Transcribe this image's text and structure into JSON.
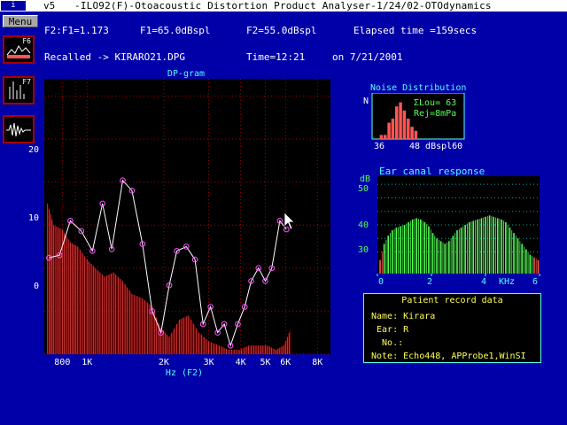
{
  "titlebar": {
    "system_button": "i",
    "version": "v5",
    "title": "-ILO92(F)-Otoacoustic Distortion Product Analyser-1/24/02-OTOdynamics"
  },
  "menu": {
    "label": "Menu"
  },
  "tools": [
    {
      "key": "F6",
      "icon": "dpgram-icon"
    },
    {
      "key": "F7",
      "icon": "spectrum-icon"
    },
    {
      "key": "",
      "icon": "waveform-icon"
    }
  ],
  "info": {
    "ratio": "F2:F1=1.173",
    "f1": "F1=65.0dBspl",
    "f2": "F2=55.0dBspl",
    "elapsed": "Elapsed time =159secs",
    "recalled": "Recalled -> KIRARO21.DPG",
    "time": "Time=12:21",
    "date": "on 7/21/2001"
  },
  "dpgram": {
    "title": "DP-gram",
    "xlabel": "Hz (F2)",
    "yticks": [
      "20",
      "10",
      "0"
    ],
    "xticks": [
      "800",
      "1K",
      "2K",
      "3K",
      "4K",
      "5K",
      "6K",
      "8K"
    ]
  },
  "noise": {
    "title": "Noise Distribution",
    "ylabel": "N",
    "lou": "ΣLou= 63",
    "rej": "Rej=8mPa",
    "xticks": [
      "36",
      "48 dBspl60"
    ]
  },
  "ear_canal": {
    "title": "Ear canal response",
    "yunit": "dB",
    "yticks": [
      "50",
      "40",
      "30"
    ],
    "xticks": [
      "0",
      "2",
      "4",
      "KHz",
      "6"
    ]
  },
  "patient": {
    "title": "Patient record data",
    "name_label": "Name:",
    "name_value": "Kirara",
    "ear_label": " Ear:",
    "ear_value": "R",
    "no_label": "  No.:",
    "no_value": "",
    "note_label": "Note:",
    "note_value": "Echo448, APProbe1,WinSI"
  },
  "chart_data": [
    {
      "type": "line",
      "title": "DP-gram",
      "xlabel": "Hz (F2)",
      "ylabel": "",
      "xscale": "log",
      "xlim": [
        680,
        9000
      ],
      "ylim": [
        -10,
        22
      ],
      "grid": true,
      "series": [
        {
          "x": [
            710,
            780,
            860,
            950,
            1050,
            1150,
            1250,
            1380,
            1500,
            1650,
            1800,
            1950,
            2100,
            2250,
            2450,
            2650,
            2850,
            3050,
            3250,
            3450,
            3650,
            3900,
            4150,
            4400,
            4700,
            5000,
            5300,
            5700,
            6050
          ],
          "values": [
            1.2,
            1.5,
            5.5,
            4.3,
            2,
            7.5,
            2.2,
            10.2,
            9,
            2.8,
            -5,
            -7.5,
            -2,
            2,
            2.5,
            1,
            -6.5,
            -4.5,
            -7.5,
            -6.5,
            -9,
            -6.5,
            -4.5,
            -1.5,
            0,
            -1.5,
            0,
            5.5,
            4.5
          ]
        }
      ],
      "noise_floor_series": {
        "x": [
          700,
          740,
          800,
          860,
          920,
          1000,
          1080,
          1170,
          1270,
          1380,
          1500,
          1650,
          1800,
          1950,
          2100,
          2300,
          2500,
          2750,
          3000,
          3300,
          3600,
          3950,
          4300,
          4700,
          5100,
          5500,
          5900,
          6300
        ],
        "values": [
          7.5,
          5,
          4.5,
          3,
          2.5,
          1,
          0,
          -1,
          -0.5,
          -1.5,
          -3,
          -3.5,
          -4.5,
          -7,
          -8,
          -6,
          -5.5,
          -7.5,
          -8.5,
          -9,
          -9.5,
          -9.5,
          -9,
          -9,
          -9,
          -9.5,
          -9,
          -7
        ]
      }
    },
    {
      "type": "bar",
      "title": "Noise Distribution",
      "xlim": [
        36,
        60
      ],
      "x": [
        38,
        39,
        40,
        41,
        42,
        43,
        44,
        45,
        46,
        47
      ],
      "values": [
        1,
        1,
        4,
        5,
        8,
        9,
        7,
        5,
        3,
        2
      ]
    },
    {
      "type": "bar",
      "title": "Ear canal response",
      "xlabel": "KHz",
      "ylabel": "dB",
      "xlim": [
        0,
        6
      ],
      "ylim": [
        22,
        58
      ],
      "x": [
        0.1,
        0.25,
        0.4,
        0.55,
        0.7,
        0.85,
        1.0,
        1.15,
        1.3,
        1.45,
        1.6,
        1.75,
        1.9,
        2.05,
        2.2,
        2.35,
        2.5,
        2.65,
        2.8,
        2.95,
        3.1,
        3.25,
        3.4,
        3.55,
        3.7,
        3.85,
        4.0,
        4.15,
        4.3,
        4.45,
        4.6,
        4.75,
        4.9,
        5.05,
        5.2,
        5.35,
        5.5,
        5.65,
        5.8,
        5.95
      ],
      "values": [
        27,
        33,
        36,
        38,
        39,
        39.5,
        40,
        41,
        42,
        42.5,
        42,
        41,
        39.5,
        37,
        35,
        34,
        33,
        34,
        36,
        38,
        39,
        40,
        41,
        41.5,
        42,
        42.5,
        43,
        43.5,
        43,
        42.5,
        42,
        41,
        39,
        37,
        35,
        33,
        31,
        29,
        28,
        27
      ]
    }
  ]
}
